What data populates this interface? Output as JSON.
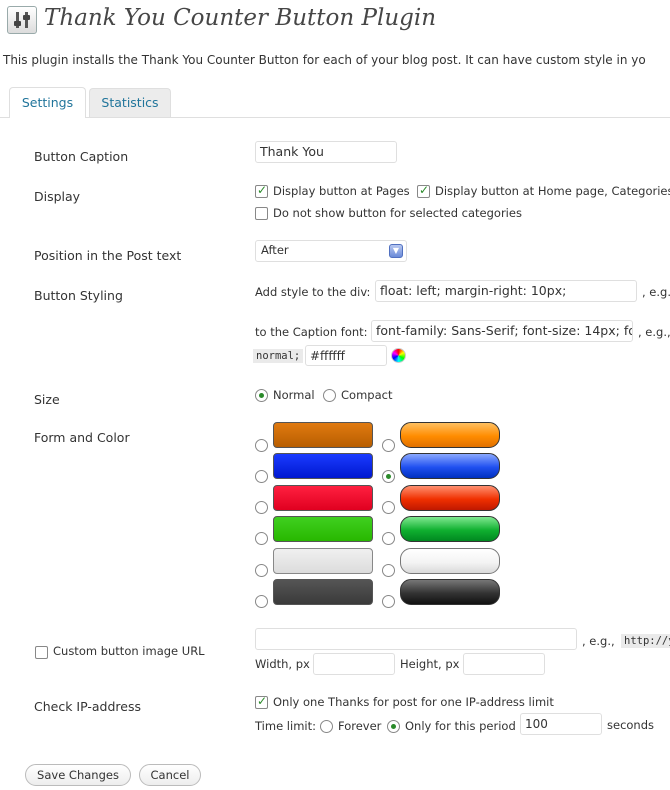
{
  "header": {
    "title": "Thank You Counter Button Plugin",
    "intro": "This plugin installs the Thank You Counter Button for each of your blog post. It can have custom style in yo"
  },
  "tabs": [
    {
      "label": "Settings",
      "active": true
    },
    {
      "label": "Statistics",
      "active": false
    }
  ],
  "form": {
    "caption": {
      "label": "Button Caption",
      "value": "Thank You"
    },
    "display": {
      "label": "Display",
      "pages": {
        "label": "Display button at Pages",
        "checked": true
      },
      "home": {
        "label": "Display button at Home page, Categories",
        "checked": true
      },
      "exclude": {
        "label": "Do not show button for selected categories",
        "checked": false
      }
    },
    "position": {
      "label": "Position in the Post text",
      "selected": "After"
    },
    "styling": {
      "label": "Button Styling",
      "div_label": "Add style to the div:",
      "div_value": "float: left; margin-right: 10px;",
      "div_eg": ", e.g.",
      "caption_label": "to the Caption font:",
      "caption_value": "font-family: Sans-Serif; font-size: 14px; font-",
      "caption_eg": ", e.g.,",
      "normal_code": "normal;",
      "color_value": "#ffffff"
    },
    "size": {
      "label": "Size",
      "options": [
        "Normal",
        "Compact"
      ],
      "selected": "Normal"
    },
    "form_color": {
      "label": "Form and Color",
      "selected_index": 3,
      "colors": [
        "#c96a00",
        "#ff8c00",
        "#0022ee",
        "#1144ee",
        "#ee0022",
        "#ee2200",
        "#22cc00",
        "#00aa22",
        "#e4e4e4",
        "#f8f8f8",
        "#444444",
        "#222222"
      ]
    },
    "custom_image": {
      "label": "Custom button image URL",
      "checked": false,
      "url_value": "",
      "eg": ", e.g.,",
      "eg_code": "http://y",
      "width_label": "Width, px",
      "height_label": "Height, px"
    },
    "ip": {
      "label": "Check IP-address",
      "only_one": {
        "label": "Only one Thanks for post for one IP-address limit",
        "checked": true
      },
      "time_limit_label": "Time limit:",
      "forever_label": "Forever",
      "period_label": "Only for this period",
      "period_value": "100",
      "seconds_label": "seconds",
      "selected": "period"
    }
  },
  "actions": {
    "save": "Save Changes",
    "cancel": "Cancel"
  }
}
